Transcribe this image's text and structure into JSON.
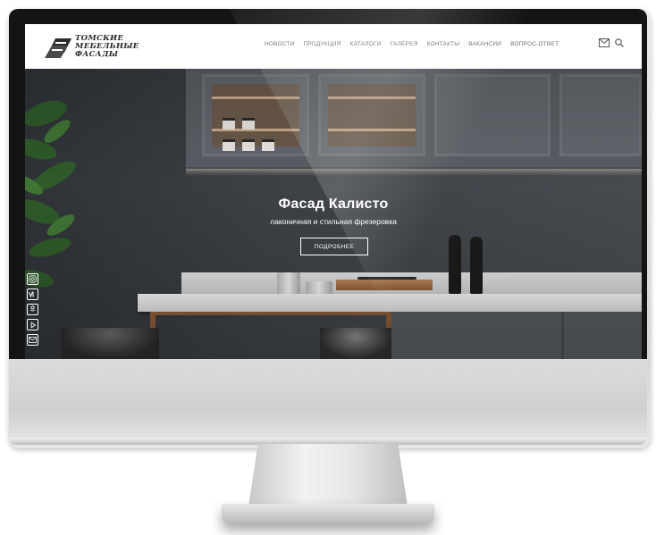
{
  "logo": {
    "lines": [
      "ТОМСКИЕ",
      "МЕБЕЛЬНЫЕ",
      "ФАСАДЫ"
    ]
  },
  "nav": {
    "items": [
      "НОВОСТИ",
      "ПРОДУКЦИЯ",
      "КАТАЛОГИ",
      "ГАЛЕРЕЯ",
      "КОНТАКТЫ",
      "ВАКАНСИИ",
      "ВОПРОС-ОТВЕТ"
    ]
  },
  "header_icons": [
    "mail-icon",
    "search-icon"
  ],
  "hero": {
    "title": "Фасад Калисто",
    "subtitle": "лаконичная и стильная фрезеровка",
    "button_label": "ПОДРОБНЕЕ"
  },
  "socials": [
    "instagram-icon",
    "vk-icon",
    "odnoklassniki-icon",
    "youtube-icon",
    "mail-icon"
  ],
  "colors": {
    "header_bg": "#ffffff",
    "nav_text": "#6d6d6d",
    "hero_text": "#ffffff",
    "cabinet": "#5a5e64"
  }
}
